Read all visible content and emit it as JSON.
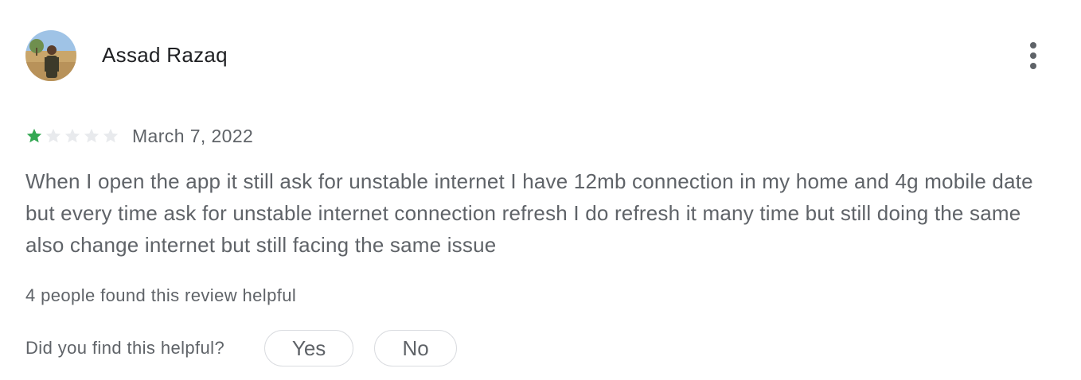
{
  "review": {
    "author": "Assad Razaq",
    "avatar_icon": "user-photo-avatar",
    "more_icon": "more-vert-icon",
    "rating": 1,
    "max_rating": 5,
    "star_filled_color": "#34a853",
    "star_empty_color": "#e8eaed",
    "date": "March 7, 2022",
    "text": "When I open the app it still ask for unstable internet I have 12mb connection in my home and 4g mobile date but every time ask for unstable internet connection refresh I do refresh it many time but still doing the same also change internet but still facing the same issue",
    "helpful_count_text": "4 people found this review helpful"
  },
  "feedback": {
    "question": "Did you find this helpful?",
    "yes_label": "Yes",
    "no_label": "No"
  }
}
